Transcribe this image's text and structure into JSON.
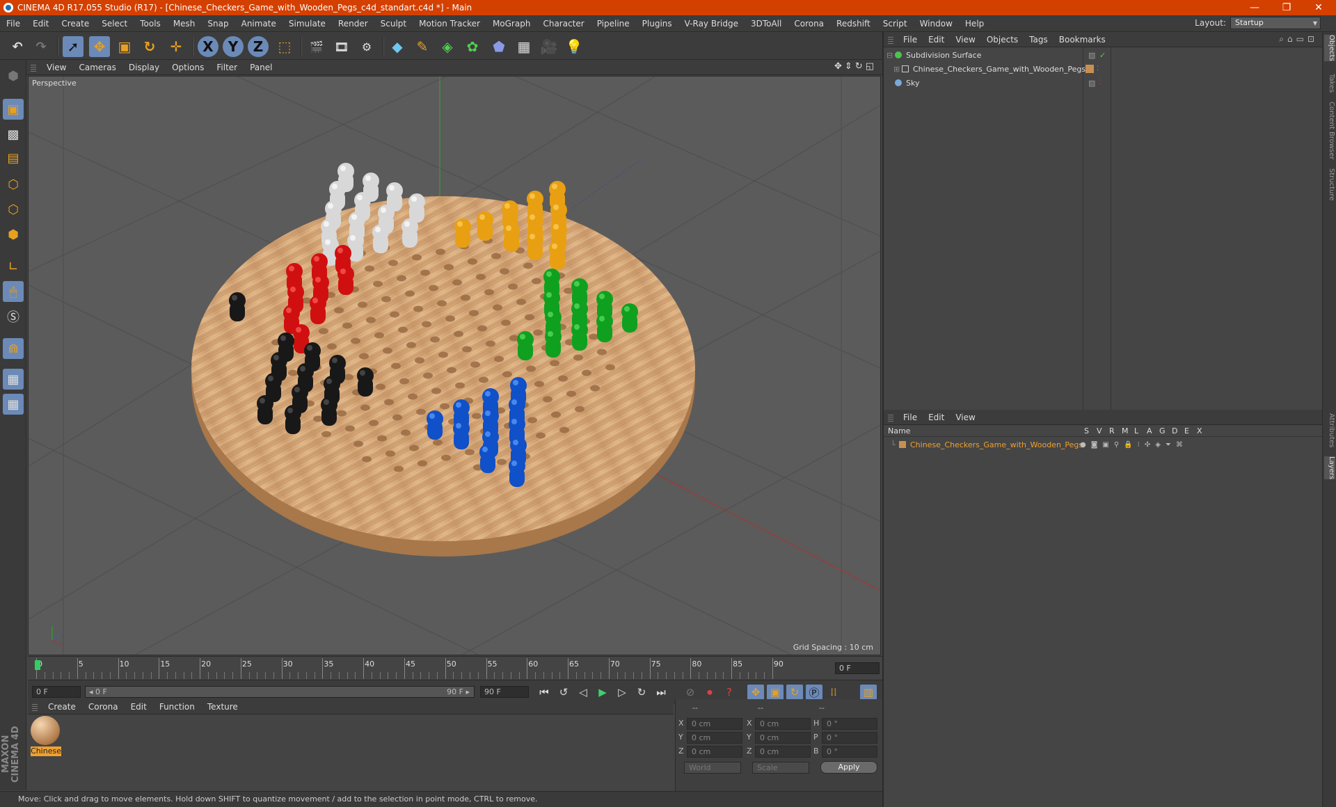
{
  "title": "CINEMA 4D R17.055 Studio (R17) - [Chinese_Checkers_Game_with_Wooden_Pegs_c4d_standart.c4d *] - Main",
  "menu": [
    "File",
    "Edit",
    "Create",
    "Select",
    "Tools",
    "Mesh",
    "Snap",
    "Animate",
    "Simulate",
    "Render",
    "Sculpt",
    "Motion Tracker",
    "MoGraph",
    "Character",
    "Pipeline",
    "Plugins",
    "V-Ray Bridge",
    "3DToAll",
    "Corona",
    "Redshift",
    "Script",
    "Window",
    "Help"
  ],
  "layout": {
    "label": "Layout:",
    "value": "Startup"
  },
  "viewport_menu": [
    "View",
    "Cameras",
    "Display",
    "Options",
    "Filter",
    "Panel"
  ],
  "viewport": {
    "label": "Perspective",
    "grid_spacing": "Grid Spacing : 10 cm"
  },
  "timeline": {
    "ticks": [
      "0",
      "5",
      "10",
      "15",
      "20",
      "25",
      "30",
      "35",
      "40",
      "45",
      "50",
      "55",
      "60",
      "65",
      "70",
      "75",
      "80",
      "85",
      "90"
    ],
    "current_frame": "0 F",
    "start_field": "0 F",
    "range_start": "◂ 0 F",
    "range_end": "90 F ▸",
    "end_field": "90 F"
  },
  "material_menu": [
    "Create",
    "Corona",
    "Edit",
    "Function",
    "Texture"
  ],
  "material": {
    "name": "Chinese"
  },
  "coords": {
    "header": [
      "--",
      "--",
      "--"
    ],
    "rows": [
      {
        "a": "X",
        "av": "0 cm",
        "b": "X",
        "bv": "0 cm",
        "c": "H",
        "cv": "0 °"
      },
      {
        "a": "Y",
        "av": "0 cm",
        "b": "Y",
        "bv": "0 cm",
        "c": "P",
        "cv": "0 °"
      },
      {
        "a": "Z",
        "av": "0 cm",
        "b": "Z",
        "bv": "0 cm",
        "c": "B",
        "cv": "0 °"
      }
    ],
    "mode1": "World",
    "mode2": "Scale",
    "apply": "Apply"
  },
  "status": "Move: Click and drag to move elements. Hold down SHIFT to quantize movement / add to the selection in point mode, CTRL to remove.",
  "objects_menu": [
    "File",
    "Edit",
    "View",
    "Objects",
    "Tags",
    "Bookmarks"
  ],
  "objects": [
    {
      "name": "Subdivision Surface",
      "color": "#4fc24f"
    },
    {
      "name": "Chinese_Checkers_Game_with_Wooden_Pegs",
      "color": "#c8c8c8"
    },
    {
      "name": "Sky",
      "color": "#7aa8d8"
    }
  ],
  "layers_menu": [
    "File",
    "Edit",
    "View"
  ],
  "layers_header": {
    "name": "Name",
    "cols": [
      "S",
      "V",
      "R",
      "M",
      "L",
      "A",
      "G",
      "D",
      "E",
      "X"
    ]
  },
  "layers": [
    {
      "name": "Chinese_Checkers_Game_with_Wooden_Pegs",
      "color": "#e8a030"
    }
  ],
  "side_tabs": [
    "Objects",
    "Takes",
    "Content Browser",
    "Structure",
    "Attributes",
    "Layers"
  ],
  "brand": "MAXON CINEMA 4D",
  "colors": {
    "accent": "#d44000",
    "selected": "#f0a030"
  }
}
